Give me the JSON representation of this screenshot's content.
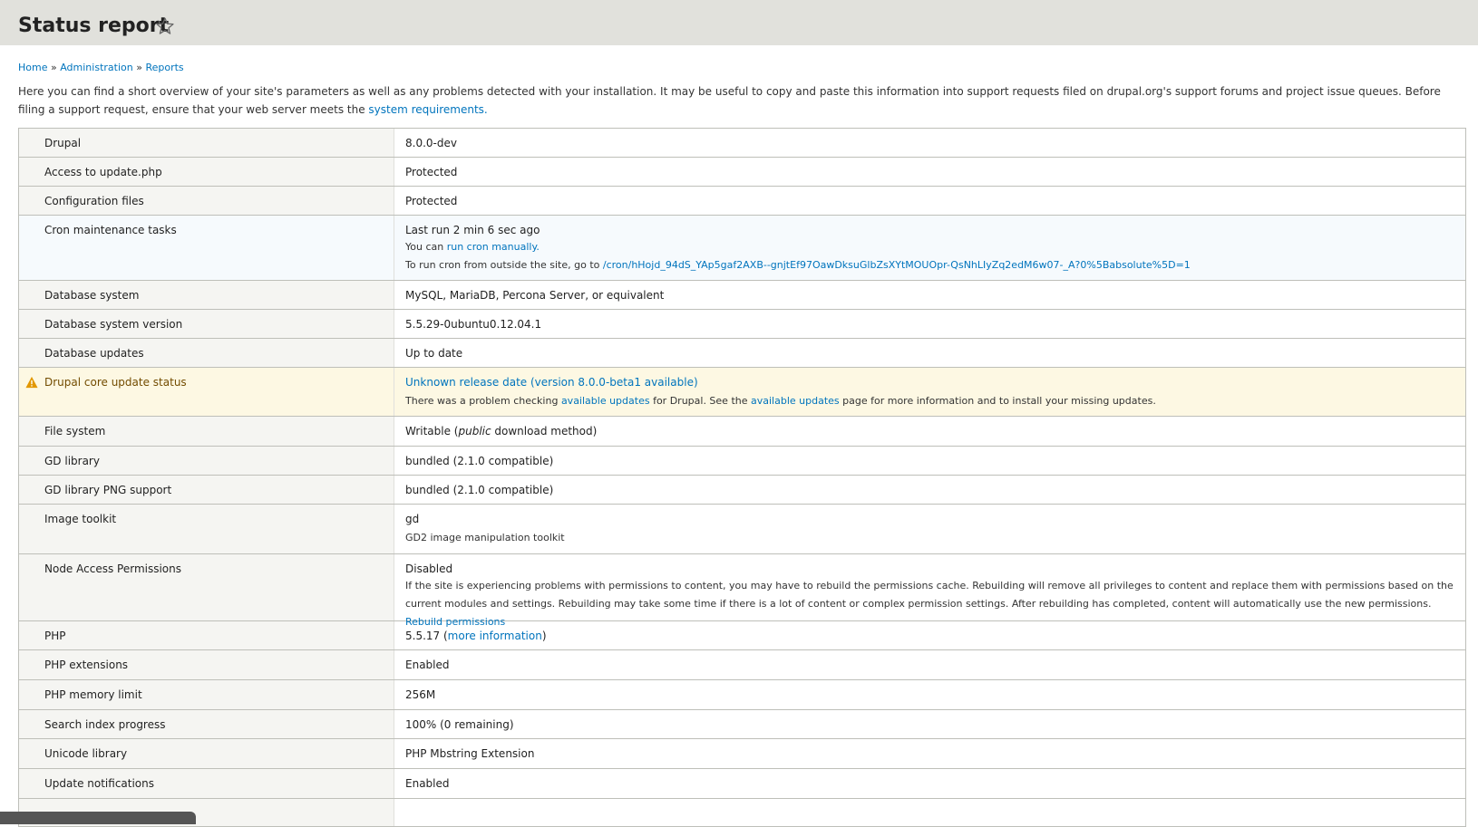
{
  "header": {
    "title": "Status report"
  },
  "breadcrumb": {
    "items": [
      "Home",
      "Administration",
      "Reports"
    ],
    "separator": "»"
  },
  "intro": {
    "text": "Here you can find a short overview of your site's parameters as well as any problems detected with your installation. It may be useful to copy and paste this information into support requests filed on drupal.org's support forums and project issue queues. Before filing a support request, ensure that your web server meets the ",
    "link": "system requirements."
  },
  "rows": {
    "drupal": {
      "label": "Drupal",
      "value": "8.0.0-dev"
    },
    "update_php": {
      "label": "Access to update.php",
      "value": "Protected"
    },
    "config_files": {
      "label": "Configuration files",
      "value": "Protected"
    },
    "cron": {
      "label": "Cron maintenance tasks",
      "value": "Last run 2 min 6 sec ago",
      "desc1_prefix": "You can ",
      "desc1_link": "run cron manually.",
      "desc2_prefix": "To run cron from outside the site, go to ",
      "desc2_link": "/cron/hHojd_94dS_YAp5gaf2AXB--gnjtEf97OawDksuGlbZsXYtMOUOpr-QsNhLIyZq2edM6w07-_A?0%5Babsolute%5D=1"
    },
    "db_system": {
      "label": "Database system",
      "value": "MySQL, MariaDB, Percona Server, or equivalent"
    },
    "db_version": {
      "label": "Database system version",
      "value": "5.5.29-0ubuntu0.12.04.1"
    },
    "db_updates": {
      "label": "Database updates",
      "value": "Up to date"
    },
    "core_update": {
      "label": "Drupal core update status",
      "value_link": "Unknown release date (version 8.0.0-beta1 available)",
      "desc_part1": "There was a problem checking ",
      "desc_link1": "available updates",
      "desc_part2": " for Drupal. See the ",
      "desc_link2": "available updates",
      "desc_part3": " page for more information and to install your missing updates."
    },
    "file_system": {
      "label": "File system",
      "value_prefix": "Writable (",
      "value_em": "public",
      "value_suffix": " download method)"
    },
    "gd_library": {
      "label": "GD library",
      "value": "bundled (2.1.0 compatible)"
    },
    "gd_png": {
      "label": "GD library PNG support",
      "value": "bundled (2.1.0 compatible)"
    },
    "image_toolkit": {
      "label": "Image toolkit",
      "value": "gd",
      "desc": "GD2 image manipulation toolkit"
    },
    "node_access": {
      "label": "Node Access Permissions",
      "value": "Disabled",
      "desc": "If the site is experiencing problems with permissions to content, you may have to rebuild the permissions cache. Rebuilding will remove all privileges to content and replace them with permissions based on the current modules and settings. Rebuilding may take some time if there is a lot of content or complex permission settings. After rebuilding has completed, content will automatically use the new permissions. ",
      "desc_link": "Rebuild permissions"
    },
    "php": {
      "label": "PHP",
      "value_prefix": "5.5.17 (",
      "value_link": "more information",
      "value_suffix": ")"
    },
    "php_ext": {
      "label": "PHP extensions",
      "value": "Enabled"
    },
    "php_mem": {
      "label": "PHP memory limit",
      "value": "256M"
    },
    "search_index": {
      "label": "Search index progress",
      "value": "100% (0 remaining)"
    },
    "unicode": {
      "label": "Unicode library",
      "value": "PHP Mbstring Extension"
    },
    "update_notif": {
      "label": "Update notifications",
      "value": "Enabled"
    }
  },
  "colors": {
    "link": "#0074bd",
    "header_bg": "#e1e1dc",
    "warning_bg": "#fdf8e3",
    "warning_icon": "#e29700"
  },
  "icons": {
    "star": "star-outline-icon",
    "warning": "warning-triangle-icon"
  }
}
